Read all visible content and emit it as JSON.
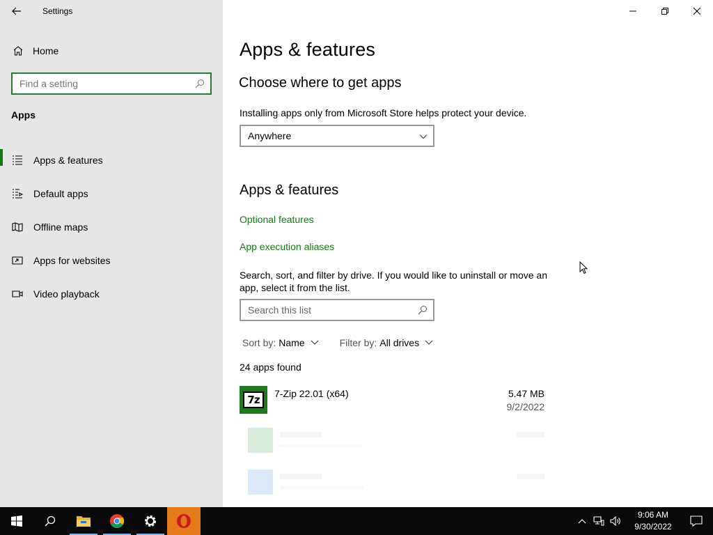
{
  "window": {
    "title": "Settings"
  },
  "sidebar": {
    "home_label": "Home",
    "search_placeholder": "Find a setting",
    "section_label": "Apps",
    "items": [
      {
        "label": "Apps & features",
        "icon": "list-icon",
        "active": true
      },
      {
        "label": "Default apps",
        "icon": "default-apps-icon",
        "active": false
      },
      {
        "label": "Offline maps",
        "icon": "map-icon",
        "active": false
      },
      {
        "label": "Apps for websites",
        "icon": "open-external-icon",
        "active": false
      },
      {
        "label": "Video playback",
        "icon": "video-icon",
        "active": false
      }
    ]
  },
  "main": {
    "title": "Apps & features",
    "choose_heading": "Choose where to get apps",
    "choose_description": "Installing apps only from Microsoft Store helps protect your device.",
    "source_selected": "Anywhere",
    "features_heading": "Apps & features",
    "link_optional_features": "Optional features",
    "link_execution_aliases": "App execution aliases",
    "list_description": "Search, sort, and filter by drive. If you would like to uninstall or move an app, select it from the list.",
    "list_search_placeholder": "Search this list",
    "sort_label": "Sort by:",
    "sort_value": "Name",
    "filter_label": "Filter by:",
    "filter_value": "All drives",
    "apps_count": "24 apps found",
    "apps": [
      {
        "name": "7-Zip 22.01 (x64)",
        "size": "5.47 MB",
        "date": "9/2/2022",
        "icon_text": "7z"
      }
    ]
  },
  "taskbar": {
    "pinned": [
      {
        "name": "start-button",
        "icon": "windows-logo-icon"
      },
      {
        "name": "search-button",
        "icon": "search-icon"
      },
      {
        "name": "file-explorer-button",
        "icon": "folder-icon"
      },
      {
        "name": "chrome-button",
        "icon": "chrome-icon"
      },
      {
        "name": "settings-button",
        "icon": "gear-icon"
      },
      {
        "name": "opera-button",
        "icon": "opera-icon"
      }
    ],
    "time": "9:06 AM",
    "date": "9/30/2022"
  },
  "colors": {
    "accent": "#107c10",
    "search_border": "#2b7a37",
    "sidebar_bg": "#e6e6e6",
    "taskbar_bg": "#0a0a0a",
    "opera_active": "#e57a1a"
  }
}
